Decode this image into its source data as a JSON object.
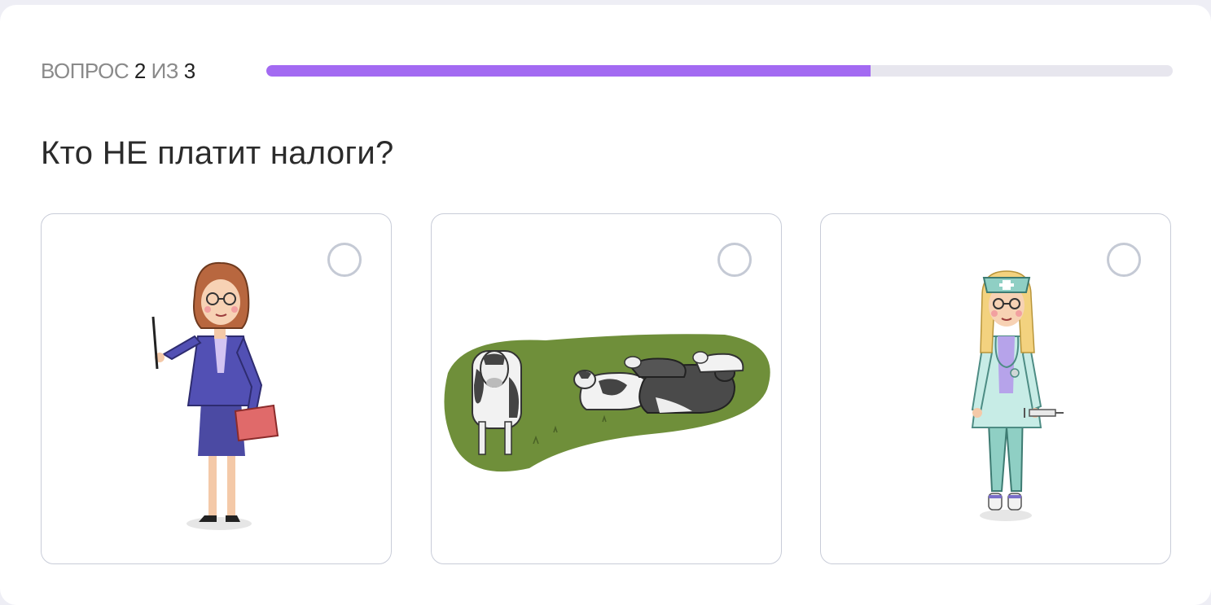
{
  "progress": {
    "prefix": "ВОПРОС",
    "current": "2",
    "separator": "ИЗ",
    "total": "3",
    "fill_fraction": 0.667
  },
  "question": "Кто НЕ платит налоги?",
  "options": [
    {
      "illustration": "teacher-illustration",
      "selected": false
    },
    {
      "illustration": "cows-illustration",
      "selected": false
    },
    {
      "illustration": "nurse-illustration",
      "selected": false
    }
  ],
  "colors": {
    "accent": "#a36af2",
    "track": "#e7e6ee",
    "card_border": "#c8ccd8"
  }
}
